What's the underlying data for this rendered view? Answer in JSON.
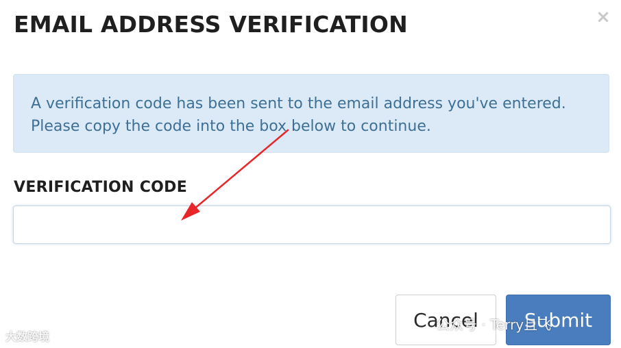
{
  "dialog": {
    "title": "EMAIL ADDRESS VERIFICATION",
    "close_glyph": "×",
    "alert": {
      "line1": "A verification code has been sent to the email address you've entered.",
      "line2": "Please copy the code into the box below to continue."
    },
    "field": {
      "label": "VERIFICATION CODE",
      "value": "",
      "placeholder": ""
    },
    "buttons": {
      "cancel": "Cancel",
      "submit": "Submit"
    }
  },
  "watermarks": {
    "left": "大数跨境",
    "right": "公众号 · Terry且飞"
  },
  "colors": {
    "alert_bg": "#dbeaf6",
    "alert_text": "#3e6f95",
    "submit_bg": "#4a7dbd",
    "arrow": "#e8262a"
  },
  "icons": {
    "close": "close-icon",
    "annotation": "red-arrow-annotation"
  }
}
